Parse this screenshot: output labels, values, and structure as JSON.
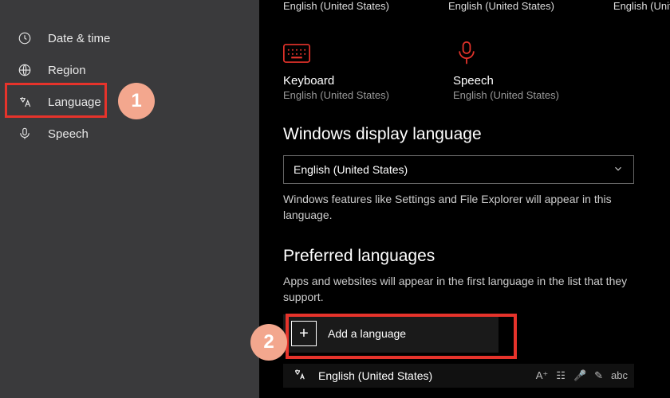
{
  "sidebar": {
    "items": [
      {
        "label": "Date & time"
      },
      {
        "label": "Region"
      },
      {
        "label": "Language"
      },
      {
        "label": "Speech"
      }
    ]
  },
  "callouts": {
    "one": "1",
    "two": "2"
  },
  "top_row": {
    "a": "English (United States)",
    "b": "English (United States)",
    "c": "English (United States)"
  },
  "devices": {
    "keyboard": {
      "title": "Keyboard",
      "sub": "English (United States)"
    },
    "speech": {
      "title": "Speech",
      "sub": "English (United States)"
    }
  },
  "display_language": {
    "heading": "Windows display language",
    "selected": "English (United States)",
    "helper": "Windows features like Settings and File Explorer will appear in this language."
  },
  "preferred": {
    "heading": "Preferred languages",
    "helper": "Apps and websites will appear in the first language in the list that they support.",
    "add_label": "Add a language",
    "row_label": "English (United States)"
  }
}
